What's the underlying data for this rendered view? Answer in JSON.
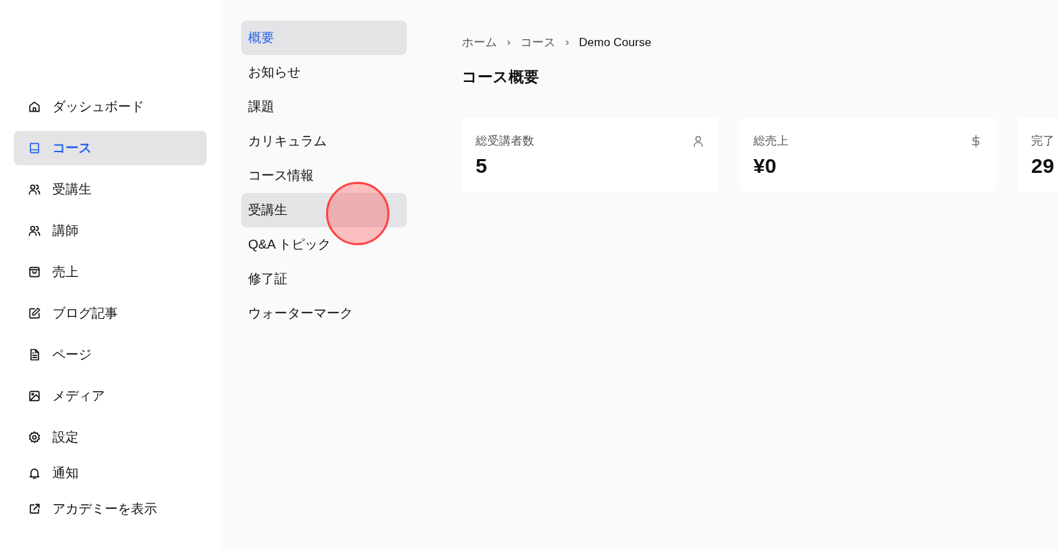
{
  "sidebar": {
    "items": [
      {
        "label": "ダッシュボード",
        "selected": false
      },
      {
        "label": "コース",
        "selected": true
      },
      {
        "label": "受講生",
        "selected": false
      },
      {
        "label": "講師",
        "selected": false
      },
      {
        "label": "売上",
        "selected": false
      },
      {
        "label": "ブログ記事",
        "selected": false
      },
      {
        "label": "ページ",
        "selected": false
      },
      {
        "label": "メディア",
        "selected": false
      },
      {
        "label": "設定",
        "selected": false
      },
      {
        "label": "通知",
        "selected": false
      },
      {
        "label": "アカデミーを表示",
        "selected": false
      }
    ]
  },
  "course_nav": {
    "items": [
      {
        "label": "概要",
        "selected": true,
        "hovered": false
      },
      {
        "label": "お知らせ",
        "selected": false,
        "hovered": false
      },
      {
        "label": "課題",
        "selected": false,
        "hovered": false
      },
      {
        "label": "カリキュラム",
        "selected": false,
        "hovered": false
      },
      {
        "label": "コース情報",
        "selected": false,
        "hovered": false
      },
      {
        "label": "受講生",
        "selected": false,
        "hovered": true
      },
      {
        "label": "Q&A トピック",
        "selected": false,
        "hovered": false
      },
      {
        "label": "修了証",
        "selected": false,
        "hovered": false
      },
      {
        "label": "ウォーターマーク",
        "selected": false,
        "hovered": false
      }
    ]
  },
  "breadcrumb": [
    "ホーム",
    "コース",
    "Demo Course"
  ],
  "page_title": "コース概要",
  "stats": [
    {
      "label": "総受講者数",
      "value": "5",
      "kind": "person"
    },
    {
      "label": "総売上",
      "value": "¥0",
      "kind": "dollar"
    },
    {
      "label": "完了",
      "value": "29",
      "kind": "none"
    }
  ],
  "touch_indicator": true
}
